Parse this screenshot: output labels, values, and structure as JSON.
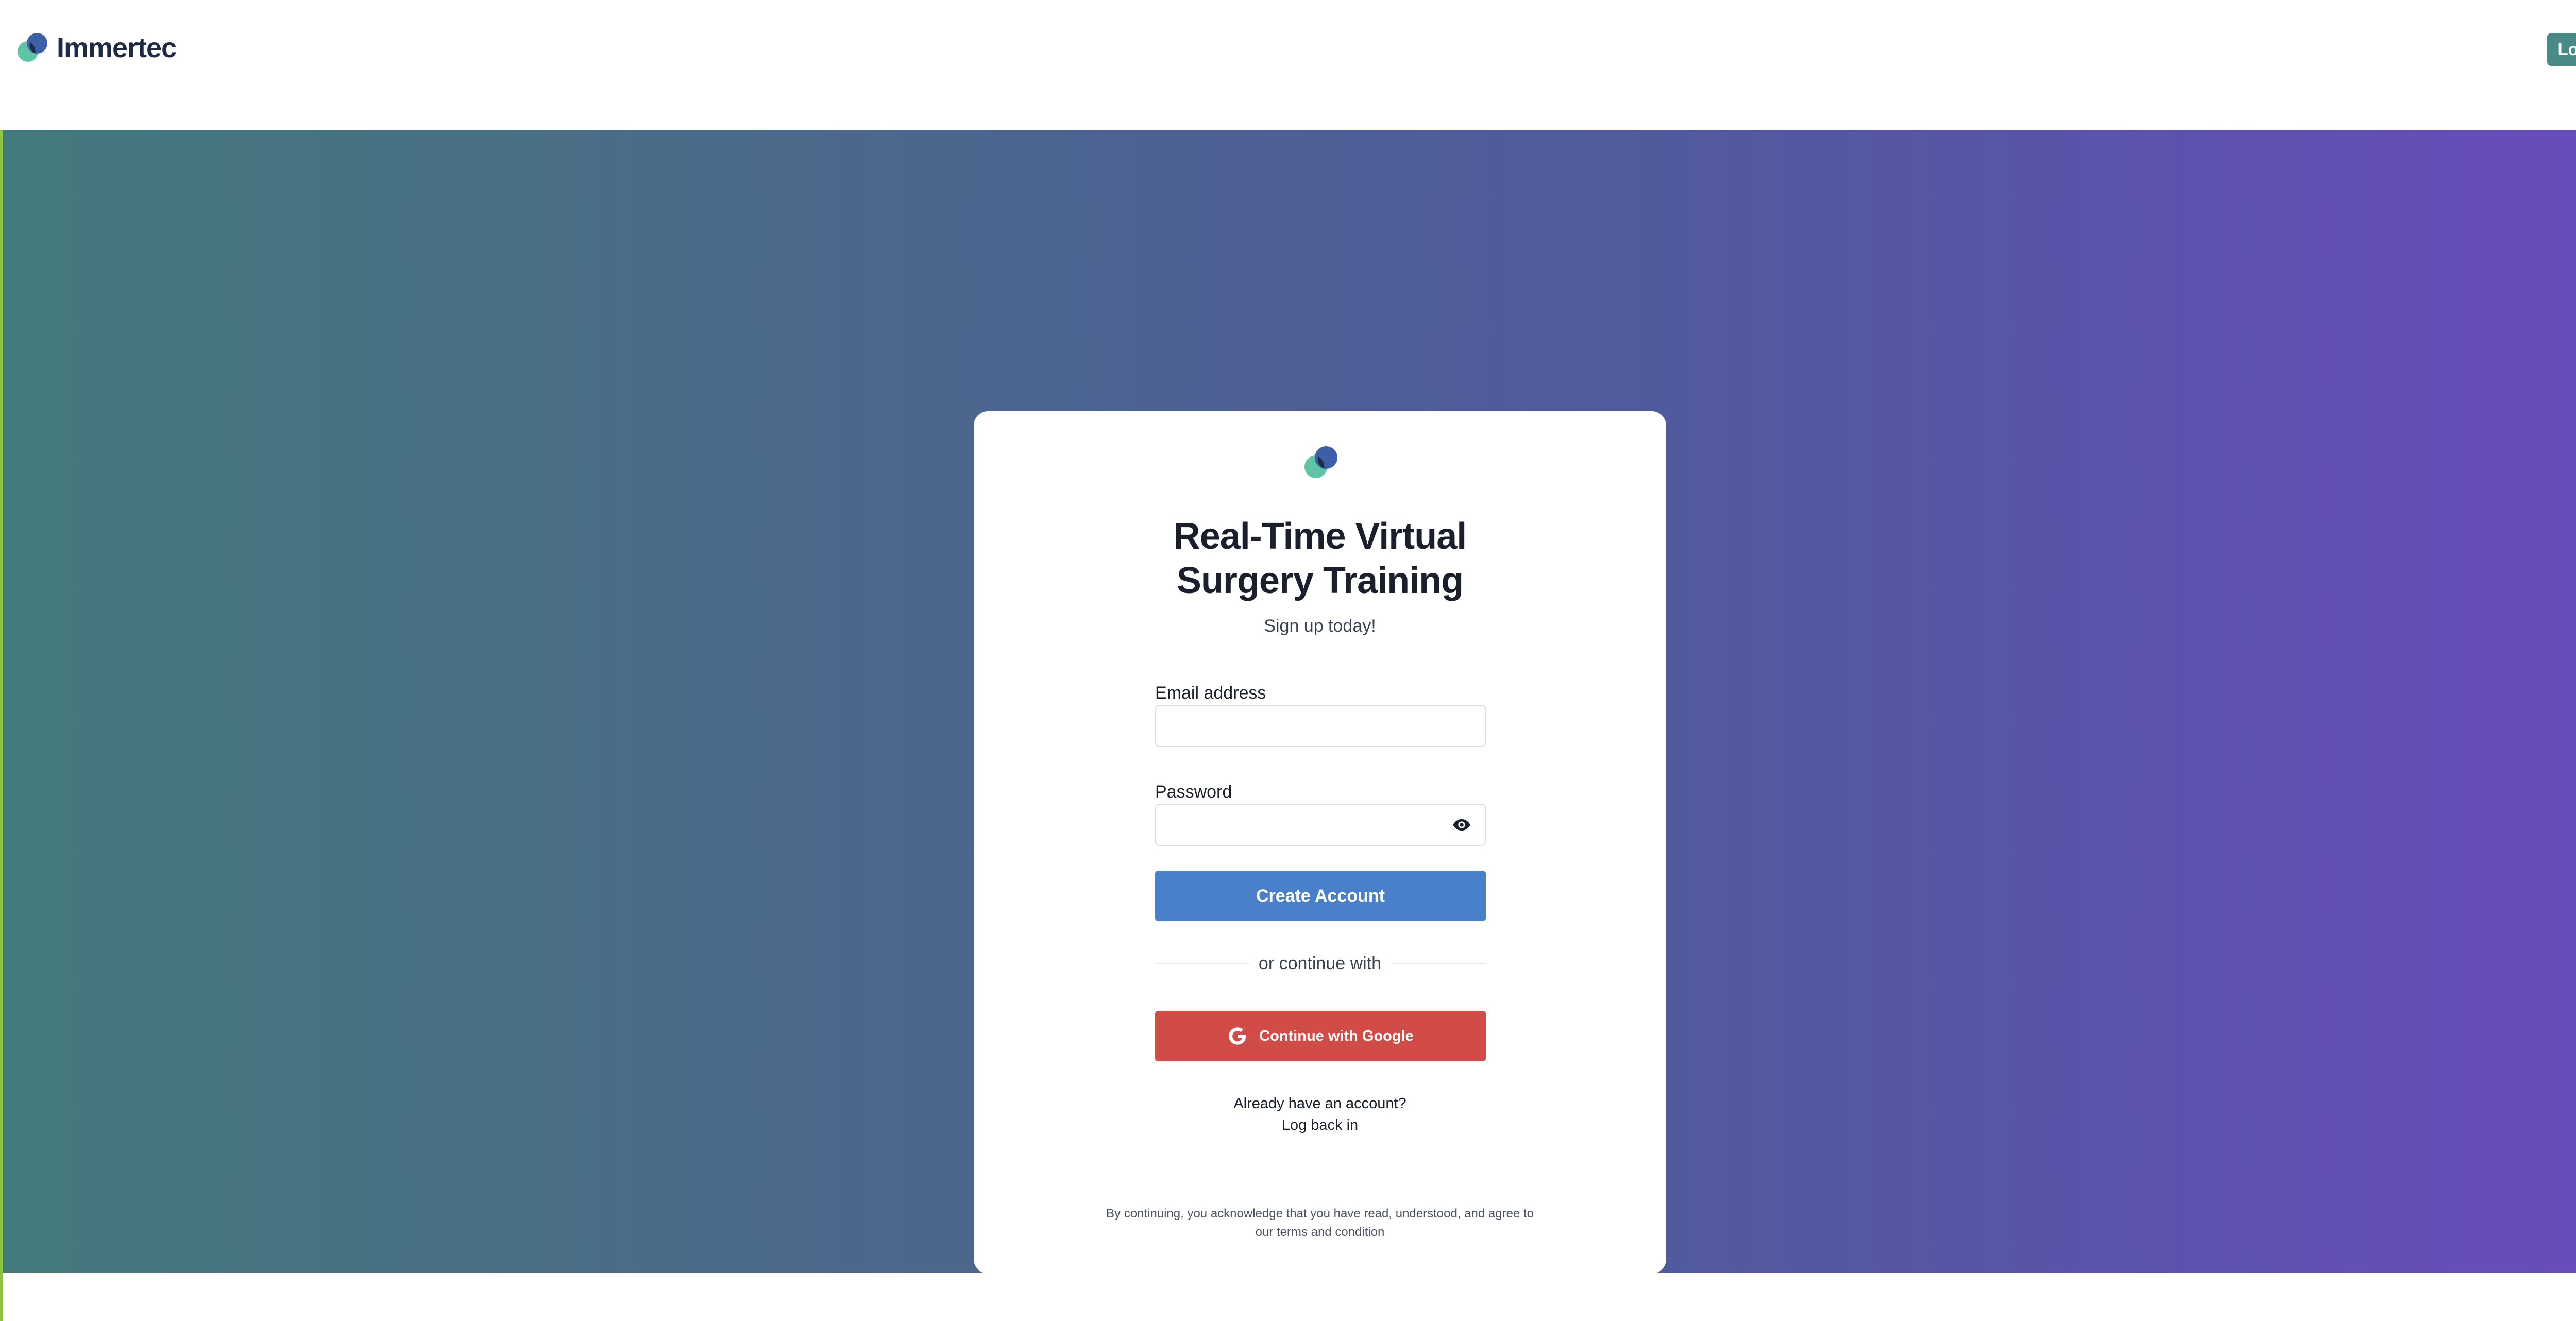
{
  "header": {
    "brand_name": "Immertec",
    "login_label": "Log In"
  },
  "card": {
    "title_line1": "Real-Time Virtual",
    "title_line2": "Surgery Training",
    "subtitle": "Sign up today!",
    "email": {
      "label": "Email address",
      "value": "",
      "placeholder": ""
    },
    "password": {
      "label": "Password",
      "value": "",
      "placeholder": ""
    },
    "create_label": "Create Account",
    "divider_text": "or continue with",
    "google_label": "Continue with Google",
    "already_text": "Already have an account?",
    "login_link": "Log back in",
    "legal_line1": "By continuing, you acknowledge that you have read, understood, and agree to",
    "legal_line2": "our terms and condition"
  },
  "icons": {
    "brand": "immertec-logo-icon",
    "eye": "eye-icon",
    "google": "google-g-icon"
  },
  "colors": {
    "brand_teal": "#4a8a86",
    "primary_blue": "#4a7fca",
    "google_red": "#d14c46",
    "gradient_start": "#437a7c",
    "gradient_end": "#6a4bbb",
    "accent_green": "#8cc63f"
  }
}
